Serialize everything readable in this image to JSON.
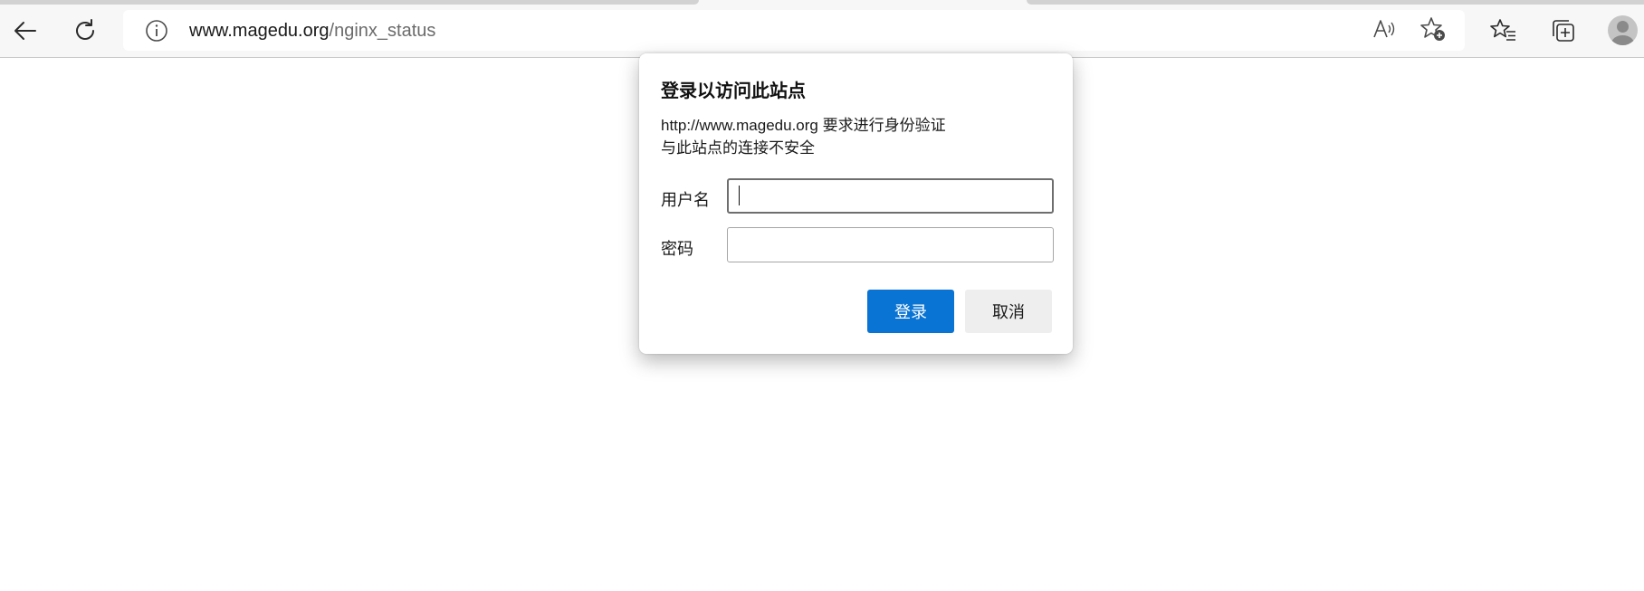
{
  "browser": {
    "address": {
      "host": "www.magedu.org",
      "path": "/nginx_status"
    },
    "icons": {
      "back": "back-arrow-icon",
      "refresh": "refresh-icon",
      "site_info": "info-icon",
      "read_aloud": "read-aloud-icon",
      "add_favorite": "add-favorite-icon",
      "favorites": "favorites-icon",
      "collections": "collections-icon",
      "profile": "profile-avatar-icon"
    }
  },
  "dialog": {
    "title": "登录以访问此站点",
    "message_line1": "http://www.magedu.org 要求进行身份验证",
    "message_line2": "与此站点的连接不安全",
    "username_label": "用户名",
    "username_value": "",
    "password_label": "密码",
    "password_value": "",
    "login_button": "登录",
    "cancel_button": "取消"
  },
  "colors": {
    "primary_button": "#0a74d4",
    "secondary_button": "#eeeeee",
    "toolbar_bg": "#f7f7f7"
  }
}
